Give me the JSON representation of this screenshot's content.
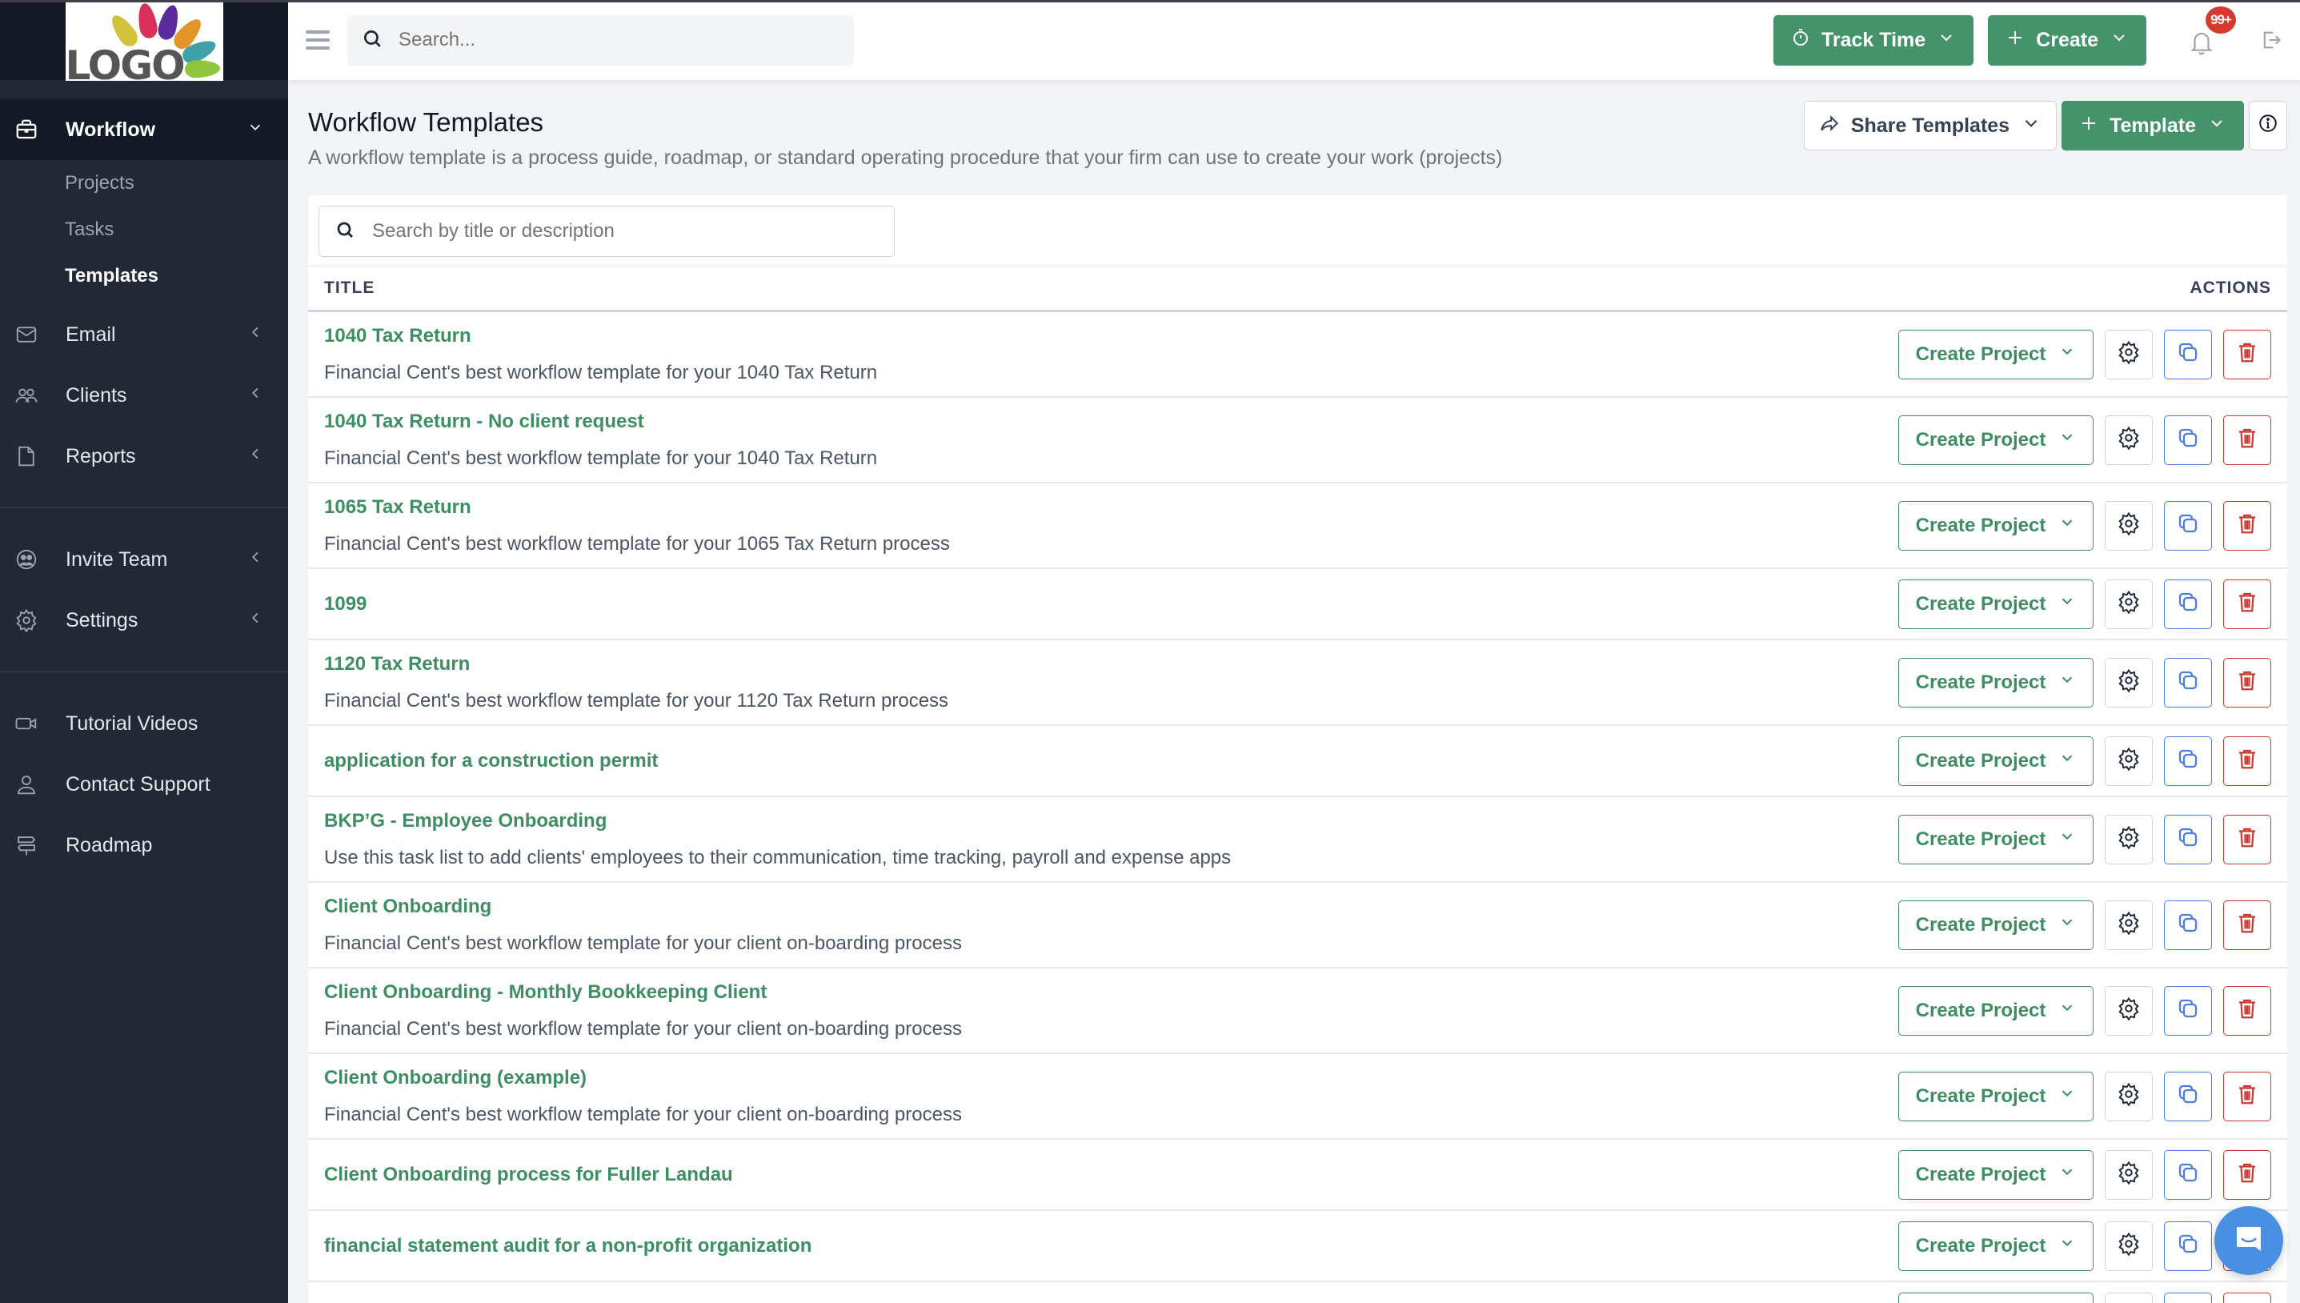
{
  "logo": {
    "text": "LOGO"
  },
  "sidebar": {
    "items": [
      {
        "label": "Workflow",
        "icon": "briefcase-icon",
        "active": true,
        "expanded": true,
        "children": [
          {
            "label": "Projects"
          },
          {
            "label": "Tasks"
          },
          {
            "label": "Templates",
            "current": true
          }
        ]
      },
      {
        "label": "Email",
        "icon": "mail-icon"
      },
      {
        "label": "Clients",
        "icon": "users-icon"
      },
      {
        "label": "Reports",
        "icon": "document-icon"
      },
      {
        "label": "Invite Team",
        "icon": "team-icon"
      },
      {
        "label": "Settings",
        "icon": "gear-icon"
      },
      {
        "label": "Tutorial Videos",
        "icon": "video-icon"
      },
      {
        "label": "Contact Support",
        "icon": "user-icon"
      },
      {
        "label": "Roadmap",
        "icon": "signpost-icon"
      }
    ]
  },
  "header": {
    "search_placeholder": "Search...",
    "track_time_label": "Track Time",
    "create_label": "Create",
    "notification_count": "99+",
    "colors": {
      "primary_green": "#44936b",
      "badge_red": "#d63a2f"
    }
  },
  "page": {
    "title": "Workflow Templates",
    "description": "A workflow template is a process guide, roadmap, or standard operating procedure that your firm can use to create your work (projects)",
    "share_templates_label": "Share Templates",
    "template_label": "Template"
  },
  "table": {
    "search_placeholder": "Search by title or description",
    "columns": {
      "title": "TITLE",
      "actions": "ACTIONS"
    },
    "create_project_label": "Create Project",
    "rows": [
      {
        "title": "1040 Tax Return",
        "description": "Financial Cent's best workflow template for your 1040 Tax Return"
      },
      {
        "title": "1040 Tax Return - No client request",
        "description": "Financial Cent's best workflow template for your 1040 Tax Return"
      },
      {
        "title": "1065 Tax Return",
        "description": "Financial Cent's best workflow template for your 1065 Tax Return process"
      },
      {
        "title": "1099",
        "description": ""
      },
      {
        "title": "1120 Tax Return",
        "description": "Financial Cent's best workflow template for your 1120 Tax Return process"
      },
      {
        "title": "application for a construction permit",
        "description": ""
      },
      {
        "title": "BKP’G - Employee Onboarding",
        "description": "Use this task list to add clients' employees to their communication, time tracking, payroll and expense apps"
      },
      {
        "title": "Client Onboarding",
        "description": "Financial Cent's best workflow template for your client on-boarding process"
      },
      {
        "title": "Client Onboarding - Monthly Bookkeeping Client",
        "description": "Financial Cent's best workflow template for your client on-boarding process"
      },
      {
        "title": "Client Onboarding (example)",
        "description": "Financial Cent's best workflow template for your client on-boarding process"
      },
      {
        "title": "Client Onboarding process for Fuller Landau",
        "description": ""
      },
      {
        "title": "financial statement audit for a non-profit organization",
        "description": ""
      },
      {
        "title": "",
        "description": ""
      }
    ]
  }
}
